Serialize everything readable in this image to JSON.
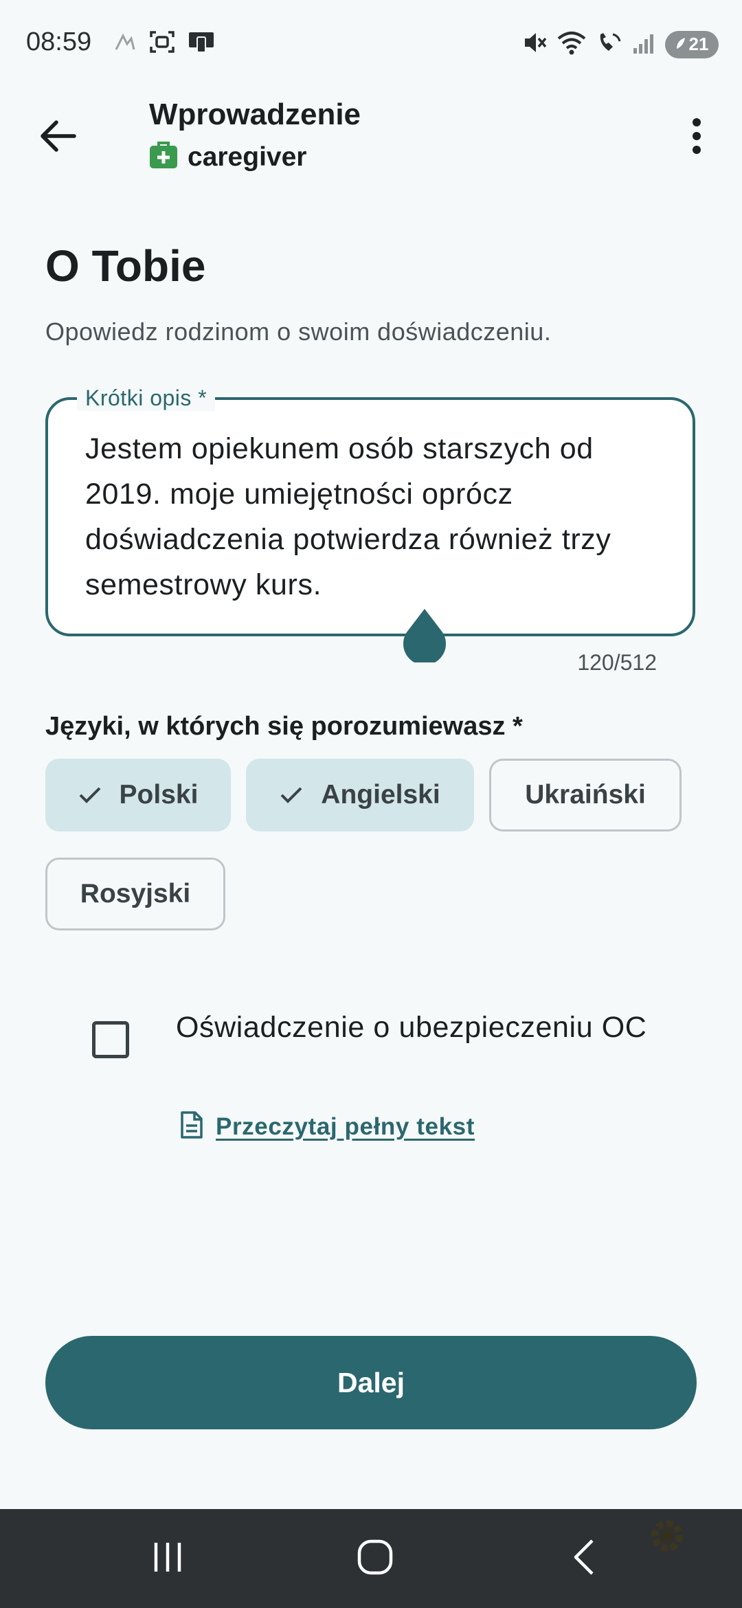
{
  "status_bar": {
    "time": "08:59",
    "battery": "21"
  },
  "header": {
    "title": "Wprowadzenie",
    "subtitle": "caregiver"
  },
  "section": {
    "title": "O Tobie",
    "subtitle": "Opowiedz rodzinom o swoim doświadczeniu."
  },
  "description_field": {
    "label": "Krótki opis *",
    "value": "Jestem opiekunem osób starszych od 2019. moje umiejętności oprócz doświadczenia potwierdza również trzy semestrowy kurs.",
    "counter": "120/512"
  },
  "languages": {
    "label": "Języki, w których się porozumiewasz *",
    "options": [
      {
        "label": "Polski",
        "selected": true
      },
      {
        "label": "Angielski",
        "selected": true
      },
      {
        "label": "Ukraiński",
        "selected": false
      },
      {
        "label": "Rosyjski",
        "selected": false
      }
    ]
  },
  "insurance": {
    "checked": false,
    "label": "Oświadczenie o ubezpieczeniu OC",
    "link": "Przeczytaj pełny tekst"
  },
  "actions": {
    "next_label": "Dalej"
  },
  "colors": {
    "primary": "#2b676e",
    "chip_selected": "#d3e6ea",
    "background": "#f5f9fa",
    "badge_green": "#3a9a4e",
    "nav_bar": "#2d3133"
  },
  "icons": {
    "back": "arrow-left-icon",
    "more": "more-vert-icon",
    "role": "medical-bag-icon",
    "check": "check-icon",
    "document": "document-icon"
  }
}
